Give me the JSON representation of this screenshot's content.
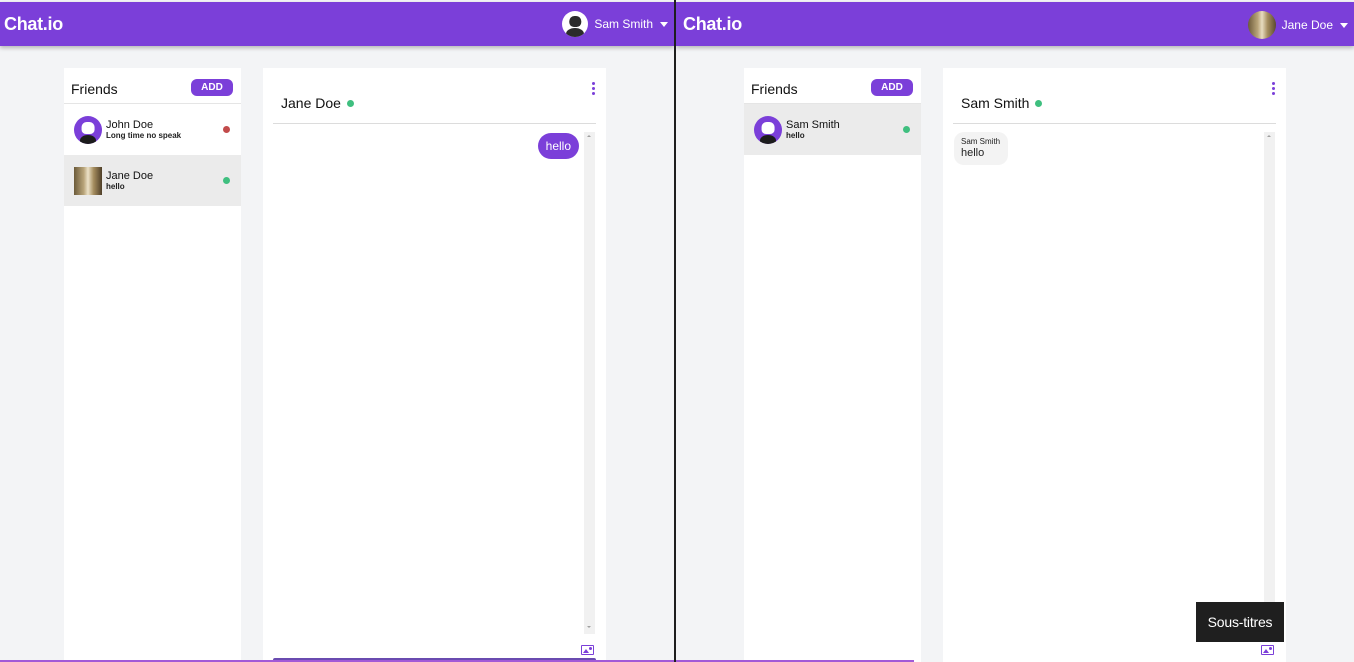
{
  "colors": {
    "accent": "#7b3fd9",
    "online": "#3fbf7f",
    "offline": "#c24b4b",
    "background": "#f3f4f6"
  },
  "left_window": {
    "brand": "Chat.io",
    "current_user": {
      "name": "Sam Smith",
      "avatar": "dark-user-avatar"
    },
    "friends": {
      "title": "Friends",
      "add_label": "ADD",
      "items": [
        {
          "name": "John Doe",
          "last_message": "Long time no speak",
          "status": "offline",
          "active": false
        },
        {
          "name": "Jane Doe",
          "last_message": "hello",
          "status": "online",
          "active": true
        }
      ]
    },
    "chat": {
      "title": "Jane Doe",
      "messages": [
        {
          "direction": "outgoing",
          "text": "hello"
        }
      ]
    }
  },
  "right_window": {
    "brand": "Chat.io",
    "current_user": {
      "name": "Jane Doe",
      "avatar": "photo-avatar"
    },
    "friends": {
      "title": "Friends",
      "add_label": "ADD",
      "items": [
        {
          "name": "Sam Smith",
          "last_message": "hello",
          "status": "online",
          "active": true
        }
      ]
    },
    "chat": {
      "title": "Sam Smith",
      "messages": [
        {
          "direction": "incoming",
          "sender": "Sam Smith",
          "text": "hello"
        }
      ]
    }
  },
  "tooltip": {
    "text": "Sous-titres"
  }
}
